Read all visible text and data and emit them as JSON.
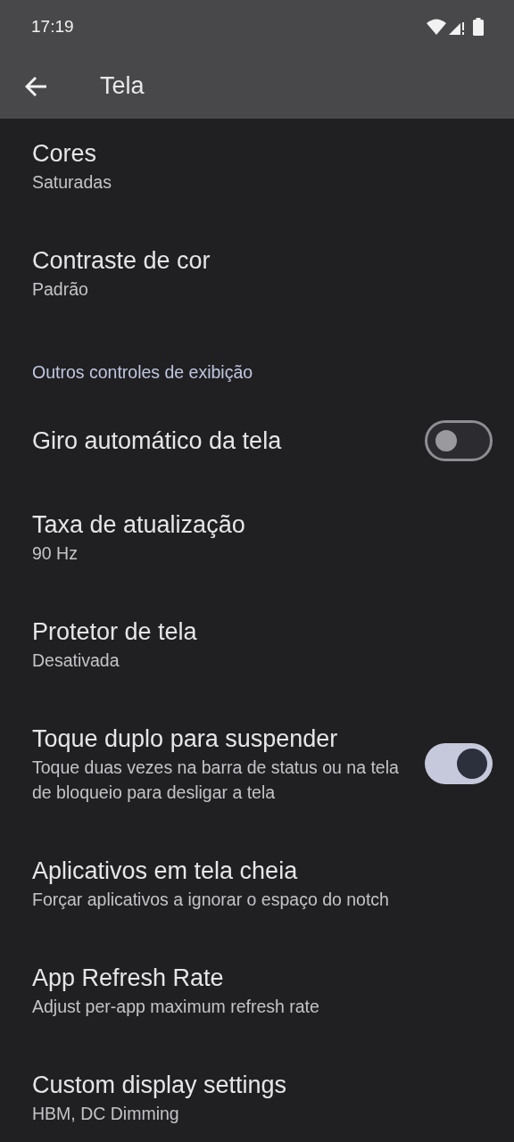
{
  "status_bar": {
    "time": "17:19"
  },
  "app_bar": {
    "title": "Tela"
  },
  "items": [
    {
      "kind": "setting",
      "title": "Cores",
      "subtitle": "Saturadas"
    },
    {
      "kind": "setting",
      "title": "Contraste de cor",
      "subtitle": "Padrão"
    },
    {
      "kind": "header",
      "title": "Outros controles de exibição"
    },
    {
      "kind": "toggle",
      "title": "Giro automático da tela",
      "on": false
    },
    {
      "kind": "setting",
      "title": "Taxa de atualização",
      "subtitle": "90 Hz"
    },
    {
      "kind": "setting",
      "title": "Protetor de tela",
      "subtitle": "Desativada"
    },
    {
      "kind": "toggle",
      "title": "Toque duplo para suspender",
      "subtitle": "Toque duas vezes na barra de status ou na tela de bloqueio para desligar a tela",
      "on": true
    },
    {
      "kind": "setting",
      "title": "Aplicativos em tela cheia",
      "subtitle": "Forçar aplicativos a ignorar o espaço do notch"
    },
    {
      "kind": "setting",
      "title": "App Refresh Rate",
      "subtitle": "Adjust per-app maximum refresh rate"
    },
    {
      "kind": "setting",
      "title": "Custom display settings",
      "subtitle": "HBM, DC Dimming"
    }
  ]
}
